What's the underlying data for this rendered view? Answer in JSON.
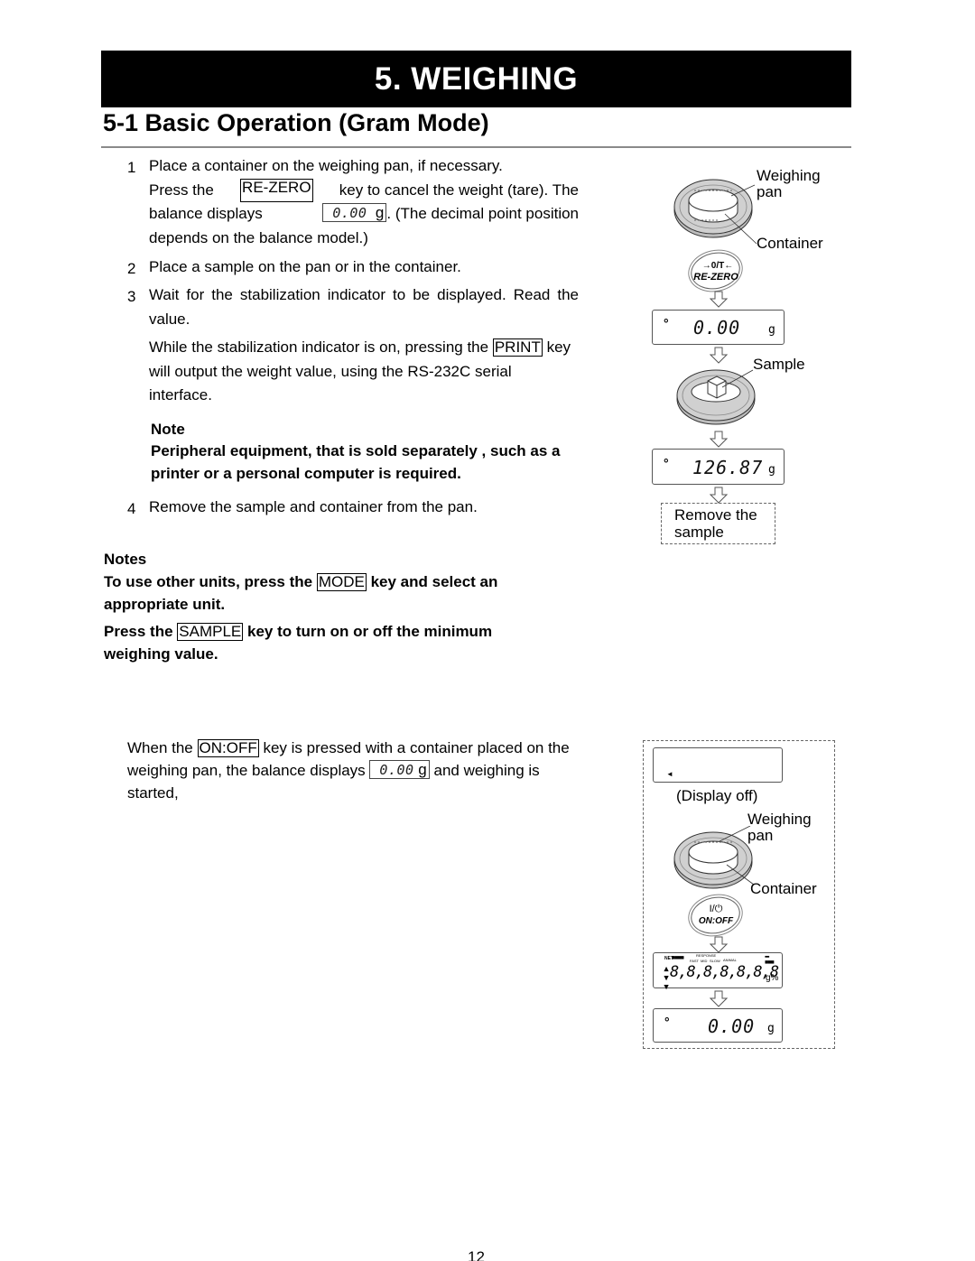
{
  "header": {
    "chapter_title": "5.  WEIGHING",
    "section_title": "5-1  Basic Operation (Gram Mode)"
  },
  "steps": [
    {
      "number": "1",
      "line1": "Place a container on the weighing pan, if necessary.",
      "press_the": "Press the",
      "key": "RE-ZERO",
      "after_key": "key to cancel the weight (tare). The",
      "balance_displays": "balance displays",
      "display_value": "0.00",
      "display_unit": "g",
      "after_display": ". (The decimal point position",
      "line4": "depends on the balance model.)"
    },
    {
      "number": "2",
      "text": "Place a sample on the pan or in the container."
    },
    {
      "number": "3",
      "text": "Wait for the stabilization indicator to be displayed. Read the value.",
      "sub_before_key": "While the stabilization indicator is on, pressing the",
      "sub_key": "PRINT",
      "sub_after_key": "key will output the weight value, using the RS-232C serial interface.",
      "note_title": "Note",
      "note_text": "Peripheral equipment, that is sold separately , such as a printer or a personal computer is required."
    },
    {
      "number": "4",
      "text": "Remove the sample and container from the pan."
    }
  ],
  "notes": {
    "title": "Notes",
    "note1_before": "To use other units, press the",
    "note1_key": "MODE",
    "note1_after": "key and select an appropriate unit.",
    "note2_before": "Press the",
    "note2_key": "SAMPLE",
    "note2_after": "key to turn on or off the minimum weighing value."
  },
  "onoff_paragraph": {
    "before_key": "When the",
    "key": "ON:OFF",
    "after_key": "key is pressed with a container placed on the weighing pan, the balance displays",
    "display_value": "0.00",
    "display_unit": "g",
    "after_display": "and weighing is started,"
  },
  "diagram1": {
    "pan_label_1": "Weighing",
    "pan_label_2": "pan",
    "container_label": "Container",
    "key_symbol": "→0/T←",
    "key_label": "RE-ZERO",
    "display1_value": "0.00",
    "display1_unit": "g",
    "sample_label": "Sample",
    "display2_value": "126.87",
    "display2_unit": "g",
    "remove_label": "Remove the sample"
  },
  "diagram2": {
    "display_off_label": "(Display off)",
    "pan_label_1": "Weighing",
    "pan_label_2": "pan",
    "container_label": "Container",
    "key_symbol": "I/⏻",
    "key_label": "ON:OFF",
    "full_display_digits": "8,8,8,8,8,8,8",
    "full_display_unit": "g%",
    "full_display_tags": [
      "NET",
      "RESPONSE",
      "FAST",
      "MID",
      "SLOW",
      "ANIMAL"
    ],
    "display_final_value": "0.00",
    "display_final_unit": "g"
  },
  "footer": {
    "page_number": "12"
  }
}
